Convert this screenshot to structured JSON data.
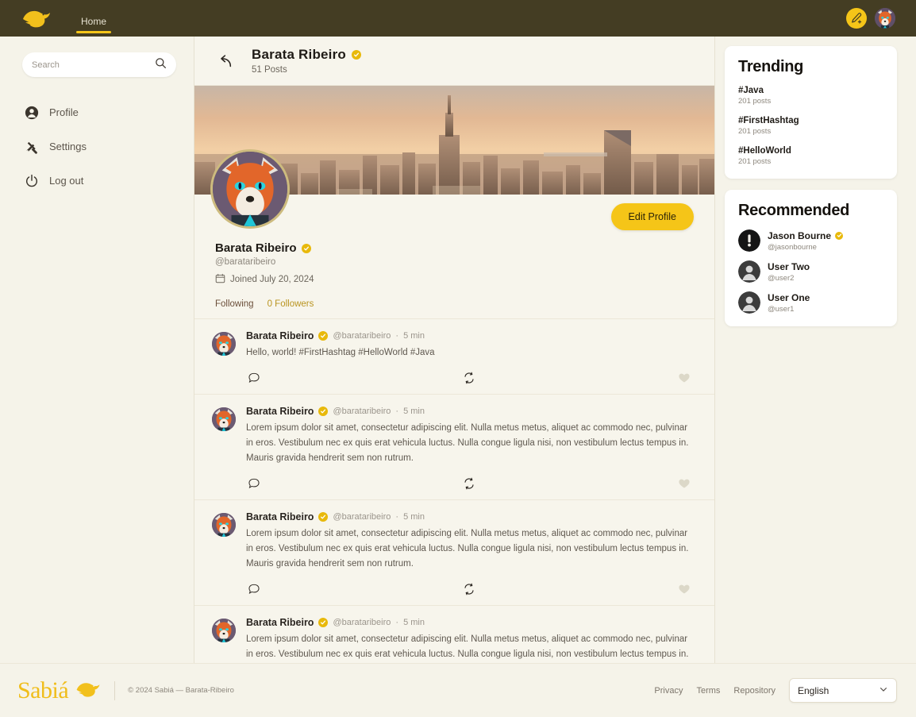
{
  "topbar": {
    "brand_icon": "bird-logo-icon",
    "nav": [
      {
        "label": "Home",
        "active": true
      }
    ],
    "compose_icon": "pencil-plus-icon",
    "avatar_icon": "user-avatar"
  },
  "sidebar": {
    "search": {
      "placeholder": "Search",
      "value": "",
      "icon": "search-icon"
    },
    "items": [
      {
        "label": "Profile",
        "icon": "user-circle-icon"
      },
      {
        "label": "Settings",
        "icon": "tools-icon"
      },
      {
        "label": "Log out",
        "icon": "power-icon"
      }
    ]
  },
  "feed_header": {
    "back_icon": "back-arrow-icon",
    "title": "Barata Ribeiro",
    "verified": true,
    "posts_count": "51 Posts"
  },
  "profile": {
    "banner_alt": "new-york-city-skyline-banner",
    "avatar_alt": "fox-avatar",
    "edit_label": "Edit Profile",
    "name": "Barata Ribeiro",
    "verified": true,
    "handle": "@barataribeiro",
    "joined_icon": "calendar-icon",
    "joined": "Joined July 20, 2024",
    "following_label": "Following",
    "followers_label": "0 Followers"
  },
  "posts": [
    {
      "author": "Barata Ribeiro",
      "verified": true,
      "handle": "@barataribeiro",
      "separator": "·",
      "time": "5 min",
      "text": "Hello, world! #FirstHashtag #HelloWorld #Java",
      "actions": {
        "comment": "comment-icon",
        "repost": "repost-icon",
        "like": "heart-icon"
      }
    },
    {
      "author": "Barata Ribeiro",
      "verified": true,
      "handle": "@barataribeiro",
      "separator": "·",
      "time": "5 min",
      "text": "Lorem ipsum dolor sit amet, consectetur adipiscing elit. Nulla metus metus, aliquet ac commodo nec, pulvinar in eros. Vestibulum nec ex quis erat vehicula luctus. Nulla congue ligula nisi, non vestibulum lectus tempus in. Mauris gravida hendrerit sem non rutrum.",
      "actions": {
        "comment": "comment-icon",
        "repost": "repost-icon",
        "like": "heart-icon"
      }
    },
    {
      "author": "Barata Ribeiro",
      "verified": true,
      "handle": "@barataribeiro",
      "separator": "·",
      "time": "5 min",
      "text": "Lorem ipsum dolor sit amet, consectetur adipiscing elit. Nulla metus metus, aliquet ac commodo nec, pulvinar in eros. Vestibulum nec ex quis erat vehicula luctus. Nulla congue ligula nisi, non vestibulum lectus tempus in. Mauris gravida hendrerit sem non rutrum.",
      "actions": {
        "comment": "comment-icon",
        "repost": "repost-icon",
        "like": "heart-icon"
      }
    },
    {
      "author": "Barata Ribeiro",
      "verified": true,
      "handle": "@barataribeiro",
      "separator": "·",
      "time": "5 min",
      "text": "Lorem ipsum dolor sit amet, consectetur adipiscing elit. Nulla metus metus, aliquet ac commodo nec, pulvinar in eros. Vestibulum nec ex quis erat vehicula luctus. Nulla congue ligula nisi, non vestibulum lectus tempus in. Mauris gravida",
      "actions": {
        "comment": "comment-icon",
        "repost": "repost-icon",
        "like": "heart-icon"
      }
    }
  ],
  "trending": {
    "title": "Trending",
    "items": [
      {
        "tag": "#Java",
        "count": "201 posts"
      },
      {
        "tag": "#FirstHashtag",
        "count": "201 posts"
      },
      {
        "tag": "#HelloWorld",
        "count": "201 posts"
      }
    ]
  },
  "recommended": {
    "title": "Recommended",
    "items": [
      {
        "name": "Jason Bourne",
        "handle": "@jasonbourne",
        "verified": true,
        "avatar": "dark-avatar"
      },
      {
        "name": "User Two",
        "handle": "@user2",
        "verified": false,
        "avatar": "default-avatar"
      },
      {
        "name": "User One",
        "handle": "@user1",
        "verified": false,
        "avatar": "default-avatar"
      }
    ]
  },
  "footer": {
    "logo_text": "Sabiá",
    "logo_icon": "bird-logo-icon",
    "copyright": "© 2024 Sabiá — Barata-Ribeiro",
    "links": [
      "Privacy",
      "Terms",
      "Repository"
    ],
    "language": {
      "value": "English",
      "chevron": "chevron-down-icon"
    }
  },
  "colors": {
    "topbar": "#443d23",
    "accent": "#f5c518",
    "background": "#f5f3e9",
    "card": "#ffffff",
    "verified": "#e8b90b"
  }
}
